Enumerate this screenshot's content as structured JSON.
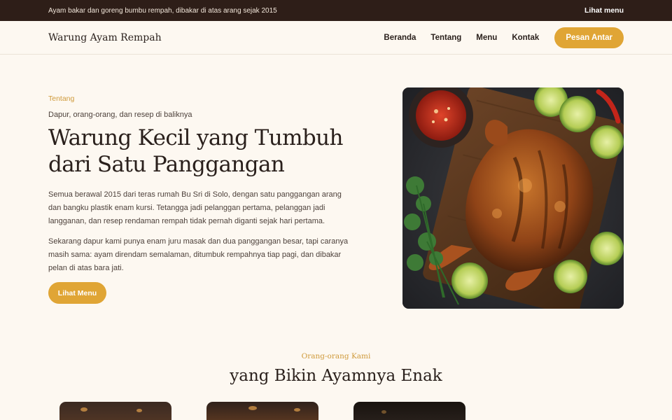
{
  "topbar": {
    "tagline": "Ayam bakar dan goreng bumbu rempah, dibakar di atas arang sejak 2015",
    "link": "Lihat menu"
  },
  "nav": {
    "brand": "Warung Ayam Rempah",
    "links": [
      "Beranda",
      "Tentang",
      "Menu",
      "Kontak"
    ],
    "cta": "Pesan Antar"
  },
  "hero": {
    "eyebrow": "Tentang",
    "subtitle": "Dapur, orang-orang, dan resep di baliknya",
    "title": "Warung Kecil yang Tumbuh dari Satu Panggangan",
    "paragraphs": [
      "Semua berawal 2015 dari teras rumah Bu Sri di Solo, dengan satu panggangan arang dan bangku plastik enam kursi. Tetangga jadi pelanggan pertama, pelanggan jadi langganan, dan resep rendaman rempah tidak pernah diganti sejak hari pertama.",
      "Sekarang dapur kami punya enam juru masak dan dua panggangan besar, tapi caranya masih sama: ayam direndam semalaman, ditumbuk rempahnya tiap pagi, dan dibakar pelan di atas bara jati."
    ],
    "button": "Lihat Menu"
  },
  "team": {
    "eyebrow": "Orang-orang Kami",
    "title": "yang Bikin Ayamnya Enak"
  },
  "colors": {
    "accent": "#e0a535",
    "topbar": "#2e1e18",
    "background": "#fdf8f1"
  }
}
